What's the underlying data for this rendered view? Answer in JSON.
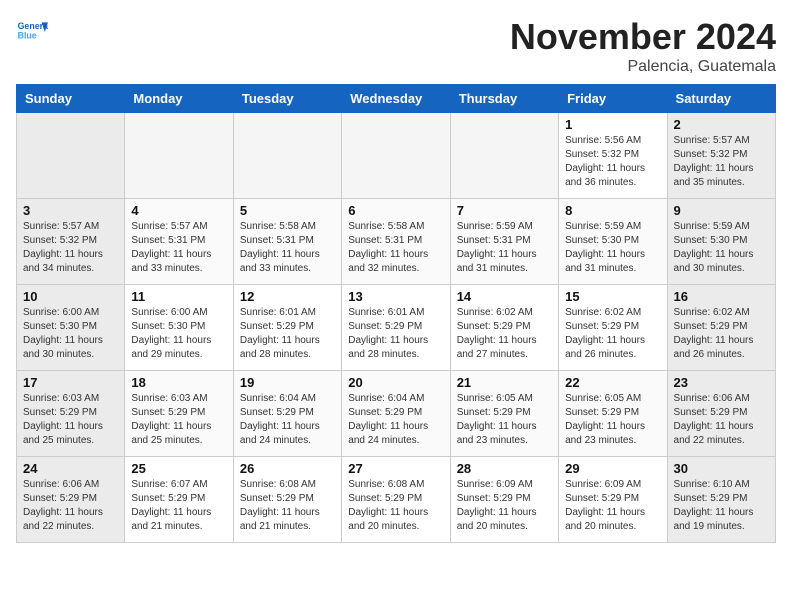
{
  "header": {
    "logo_line1": "General",
    "logo_line2": "Blue",
    "month": "November 2024",
    "location": "Palencia, Guatemala"
  },
  "weekdays": [
    "Sunday",
    "Monday",
    "Tuesday",
    "Wednesday",
    "Thursday",
    "Friday",
    "Saturday"
  ],
  "weeks": [
    [
      {
        "day": "",
        "info": ""
      },
      {
        "day": "",
        "info": ""
      },
      {
        "day": "",
        "info": ""
      },
      {
        "day": "",
        "info": ""
      },
      {
        "day": "",
        "info": ""
      },
      {
        "day": "1",
        "info": "Sunrise: 5:56 AM\nSunset: 5:32 PM\nDaylight: 11 hours and 36 minutes."
      },
      {
        "day": "2",
        "info": "Sunrise: 5:57 AM\nSunset: 5:32 PM\nDaylight: 11 hours and 35 minutes."
      }
    ],
    [
      {
        "day": "3",
        "info": "Sunrise: 5:57 AM\nSunset: 5:32 PM\nDaylight: 11 hours and 34 minutes."
      },
      {
        "day": "4",
        "info": "Sunrise: 5:57 AM\nSunset: 5:31 PM\nDaylight: 11 hours and 33 minutes."
      },
      {
        "day": "5",
        "info": "Sunrise: 5:58 AM\nSunset: 5:31 PM\nDaylight: 11 hours and 33 minutes."
      },
      {
        "day": "6",
        "info": "Sunrise: 5:58 AM\nSunset: 5:31 PM\nDaylight: 11 hours and 32 minutes."
      },
      {
        "day": "7",
        "info": "Sunrise: 5:59 AM\nSunset: 5:31 PM\nDaylight: 11 hours and 31 minutes."
      },
      {
        "day": "8",
        "info": "Sunrise: 5:59 AM\nSunset: 5:30 PM\nDaylight: 11 hours and 31 minutes."
      },
      {
        "day": "9",
        "info": "Sunrise: 5:59 AM\nSunset: 5:30 PM\nDaylight: 11 hours and 30 minutes."
      }
    ],
    [
      {
        "day": "10",
        "info": "Sunrise: 6:00 AM\nSunset: 5:30 PM\nDaylight: 11 hours and 30 minutes."
      },
      {
        "day": "11",
        "info": "Sunrise: 6:00 AM\nSunset: 5:30 PM\nDaylight: 11 hours and 29 minutes."
      },
      {
        "day": "12",
        "info": "Sunrise: 6:01 AM\nSunset: 5:29 PM\nDaylight: 11 hours and 28 minutes."
      },
      {
        "day": "13",
        "info": "Sunrise: 6:01 AM\nSunset: 5:29 PM\nDaylight: 11 hours and 28 minutes."
      },
      {
        "day": "14",
        "info": "Sunrise: 6:02 AM\nSunset: 5:29 PM\nDaylight: 11 hours and 27 minutes."
      },
      {
        "day": "15",
        "info": "Sunrise: 6:02 AM\nSunset: 5:29 PM\nDaylight: 11 hours and 26 minutes."
      },
      {
        "day": "16",
        "info": "Sunrise: 6:02 AM\nSunset: 5:29 PM\nDaylight: 11 hours and 26 minutes."
      }
    ],
    [
      {
        "day": "17",
        "info": "Sunrise: 6:03 AM\nSunset: 5:29 PM\nDaylight: 11 hours and 25 minutes."
      },
      {
        "day": "18",
        "info": "Sunrise: 6:03 AM\nSunset: 5:29 PM\nDaylight: 11 hours and 25 minutes."
      },
      {
        "day": "19",
        "info": "Sunrise: 6:04 AM\nSunset: 5:29 PM\nDaylight: 11 hours and 24 minutes."
      },
      {
        "day": "20",
        "info": "Sunrise: 6:04 AM\nSunset: 5:29 PM\nDaylight: 11 hours and 24 minutes."
      },
      {
        "day": "21",
        "info": "Sunrise: 6:05 AM\nSunset: 5:29 PM\nDaylight: 11 hours and 23 minutes."
      },
      {
        "day": "22",
        "info": "Sunrise: 6:05 AM\nSunset: 5:29 PM\nDaylight: 11 hours and 23 minutes."
      },
      {
        "day": "23",
        "info": "Sunrise: 6:06 AM\nSunset: 5:29 PM\nDaylight: 11 hours and 22 minutes."
      }
    ],
    [
      {
        "day": "24",
        "info": "Sunrise: 6:06 AM\nSunset: 5:29 PM\nDaylight: 11 hours and 22 minutes."
      },
      {
        "day": "25",
        "info": "Sunrise: 6:07 AM\nSunset: 5:29 PM\nDaylight: 11 hours and 21 minutes."
      },
      {
        "day": "26",
        "info": "Sunrise: 6:08 AM\nSunset: 5:29 PM\nDaylight: 11 hours and 21 minutes."
      },
      {
        "day": "27",
        "info": "Sunrise: 6:08 AM\nSunset: 5:29 PM\nDaylight: 11 hours and 20 minutes."
      },
      {
        "day": "28",
        "info": "Sunrise: 6:09 AM\nSunset: 5:29 PM\nDaylight: 11 hours and 20 minutes."
      },
      {
        "day": "29",
        "info": "Sunrise: 6:09 AM\nSunset: 5:29 PM\nDaylight: 11 hours and 20 minutes."
      },
      {
        "day": "30",
        "info": "Sunrise: 6:10 AM\nSunset: 5:29 PM\nDaylight: 11 hours and 19 minutes."
      }
    ]
  ]
}
